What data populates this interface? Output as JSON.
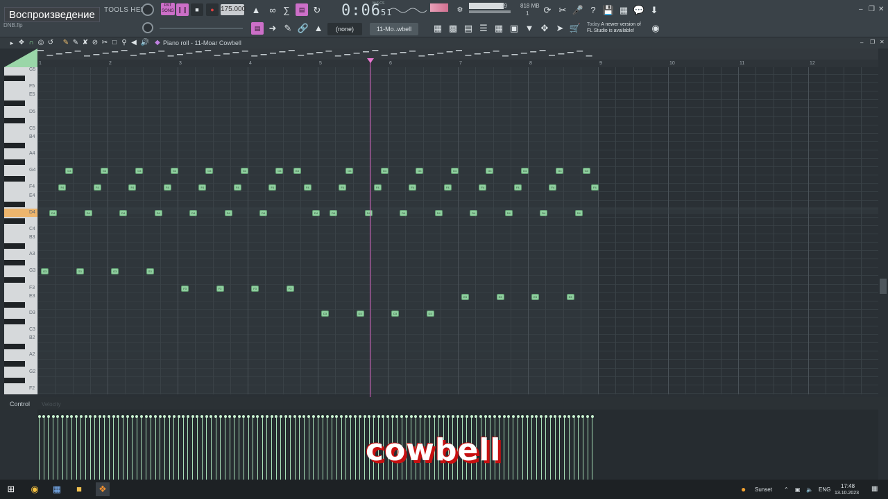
{
  "app": {
    "tooltip": "Воспроизведение",
    "menu_partial": "TOOLS  HELP",
    "file_name": "DNB.flp",
    "tempo": "175.000",
    "time": "0:06",
    "time_small": "51",
    "time_label": "M:S:CS",
    "mem_value": "39",
    "mem_mb": "818 MB",
    "mem_voices": "1",
    "pattern_none": "(none)",
    "pattern_name": "11-Mo..wbell",
    "hint_today": "Today",
    "hint_line1": "A newer version of",
    "hint_line2": "FL Studio is available!"
  },
  "piano_roll": {
    "title": "Piano roll - 11-Moar Cowbell",
    "bars": [
      "1",
      "2",
      "3",
      "4",
      "5",
      "6",
      "7",
      "8",
      "9",
      "10",
      "11",
      "12"
    ],
    "key_labels": [
      {
        "name": "G5"
      },
      {
        "name": "F5"
      },
      {
        "name": "E5"
      },
      {
        "name": "D5"
      },
      {
        "name": "C5"
      },
      {
        "name": "B4"
      },
      {
        "name": "A4"
      },
      {
        "name": "G4"
      },
      {
        "name": "F4"
      },
      {
        "name": "E4"
      },
      {
        "name": "D4"
      },
      {
        "name": "C4"
      },
      {
        "name": "B3"
      },
      {
        "name": "A3"
      },
      {
        "name": "G3"
      },
      {
        "name": "F3"
      },
      {
        "name": "E3"
      },
      {
        "name": "D3"
      },
      {
        "name": "C3"
      },
      {
        "name": "B2"
      },
      {
        "name": "A2"
      },
      {
        "name": "G2"
      },
      {
        "name": "F2"
      }
    ],
    "notes_G4": [
      0.4,
      0.9,
      1.4,
      1.9,
      2.4,
      2.9,
      3.4,
      3.65,
      4.4,
      4.9,
      5.4,
      5.9,
      6.4,
      6.9,
      7.4,
      7.78
    ],
    "notes_F4": [
      0.3,
      0.8,
      1.3,
      1.8,
      2.3,
      2.8,
      3.3,
      3.8,
      4.3,
      4.8,
      5.3,
      5.8,
      6.3,
      6.8,
      7.3,
      7.9
    ],
    "notes_D4": [
      0.17,
      0.67,
      1.17,
      1.67,
      2.17,
      2.67,
      3.17,
      3.92,
      4.17,
      4.67,
      5.17,
      5.67,
      6.17,
      6.67,
      7.17,
      7.67
    ],
    "notes_G3": [
      0.05,
      0.55,
      1.05,
      1.55
    ],
    "notes_F3": [
      2.05,
      2.55,
      3.05,
      3.55
    ],
    "notes_E3": [
      6.05,
      6.55,
      7.05,
      7.55
    ],
    "notes_D3": [
      4.05,
      4.55,
      5.05,
      5.55
    ],
    "note_labels": {
      "G4": "G4",
      "F4": "F4",
      "D4": "D4",
      "G3": "G3",
      "F3": "F3",
      "E3": "E3",
      "D3": "D3"
    }
  },
  "control": {
    "label": "Control",
    "target": "Velocity"
  },
  "caption": "cowbell",
  "taskbar": {
    "weather": "Sunset",
    "lang": "ENG",
    "time": "17:48",
    "date": "13.10.2023"
  }
}
